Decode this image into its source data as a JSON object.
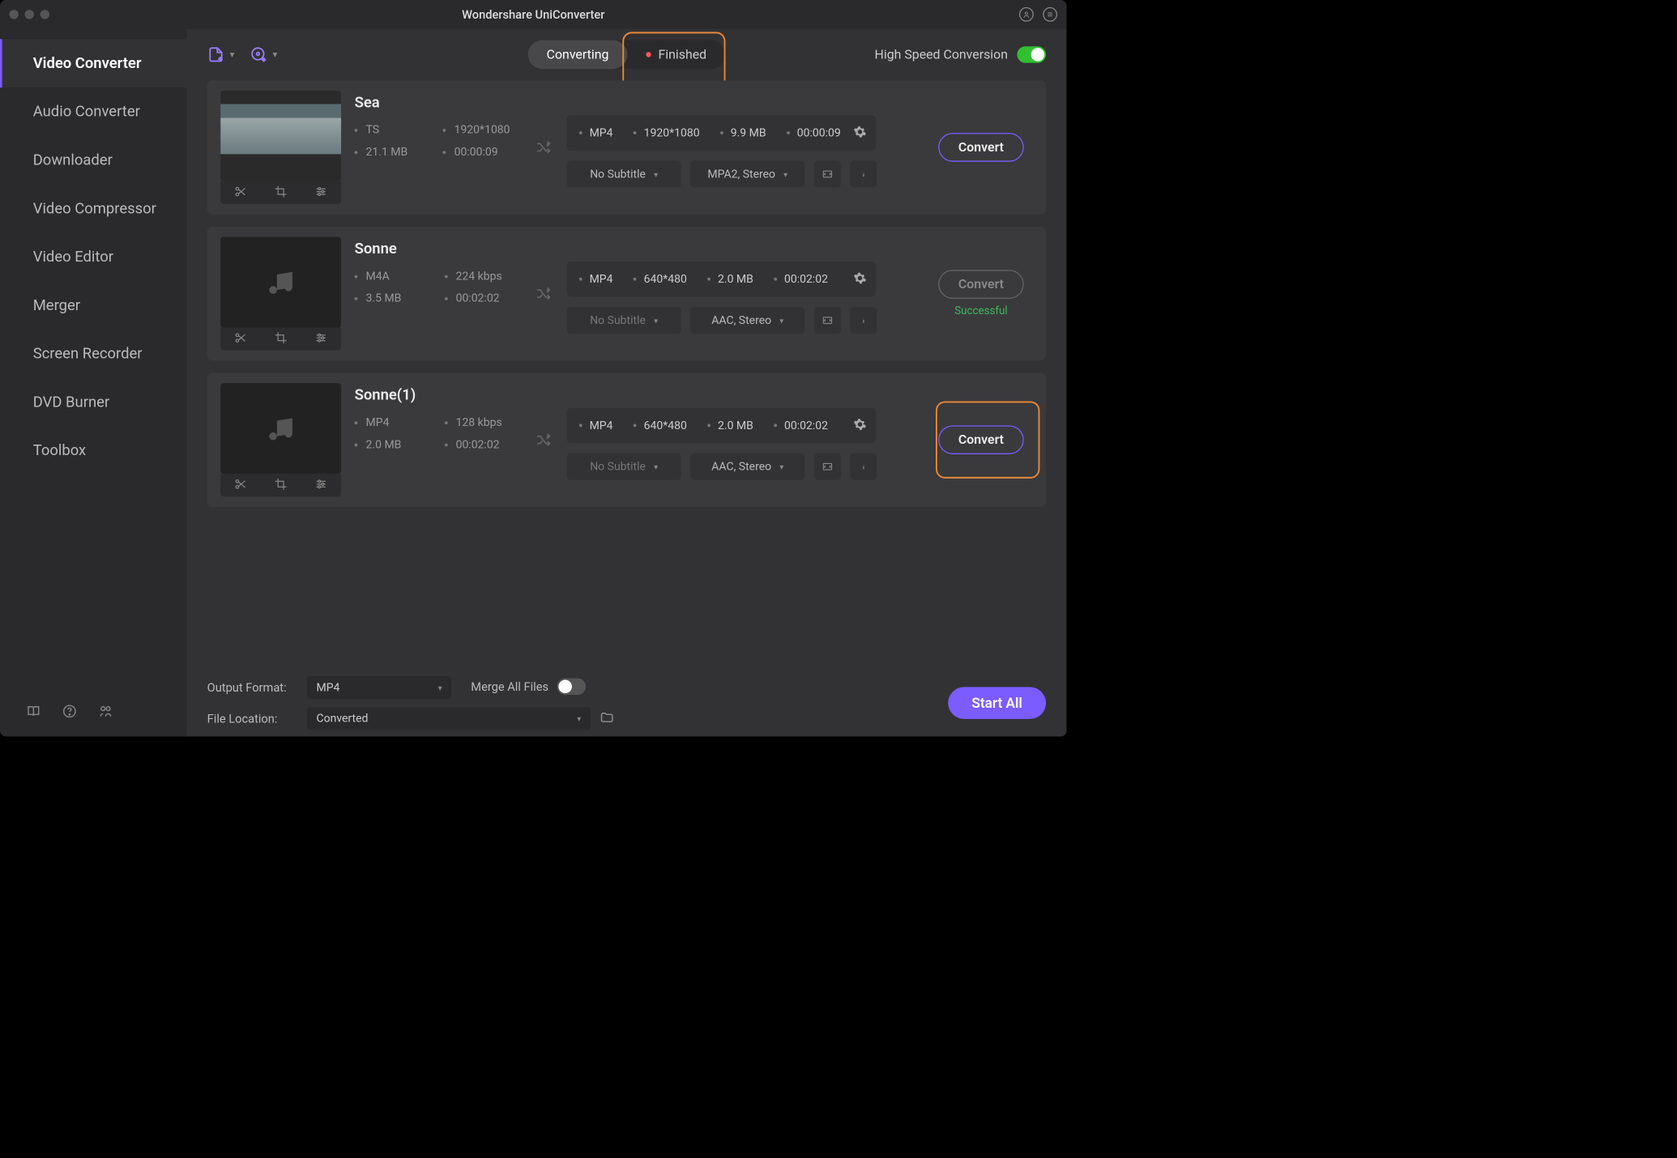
{
  "title": "Wondershare UniConverter",
  "sidebar": {
    "items": [
      "Video Converter",
      "Audio Converter",
      "Downloader",
      "Video Compressor",
      "Video Editor",
      "Merger",
      "Screen Recorder",
      "DVD Burner",
      "Toolbox"
    ],
    "active_index": 0
  },
  "tabs": {
    "converting": "Converting",
    "finished": "Finished"
  },
  "high_speed": {
    "label": "High Speed Conversion",
    "on": true
  },
  "items": [
    {
      "title": "Sea",
      "thumb": "sea",
      "src_meta": [
        "TS",
        "1920*1080",
        "21.1 MB",
        "00:00:09"
      ],
      "out_meta": [
        "MP4",
        "1920*1080",
        "9.9 MB",
        "00:00:09"
      ],
      "subtitle": "No Subtitle",
      "audio": "MPA2, Stereo",
      "convert_label": "Convert",
      "disabled": false,
      "status": "",
      "highlight": false
    },
    {
      "title": "Sonne",
      "thumb": "music",
      "src_meta": [
        "M4A",
        "224 kbps",
        "3.5 MB",
        "00:02:02"
      ],
      "out_meta": [
        "MP4",
        "640*480",
        "2.0 MB",
        "00:02:02"
      ],
      "subtitle": "No Subtitle",
      "audio": "AAC, Stereo",
      "convert_label": "Convert",
      "disabled": true,
      "status": "Successful",
      "highlight": false
    },
    {
      "title": "Sonne(1)",
      "thumb": "music",
      "src_meta": [
        "MP4",
        "128 kbps",
        "2.0 MB",
        "00:02:02"
      ],
      "out_meta": [
        "MP4",
        "640*480",
        "2.0 MB",
        "00:02:02"
      ],
      "subtitle": "No Subtitle",
      "audio": "AAC, Stereo",
      "convert_label": "Convert",
      "disabled": false,
      "status": "",
      "highlight": true
    }
  ],
  "footer": {
    "output_format_label": "Output Format:",
    "output_format_value": "MP4",
    "file_location_label": "File Location:",
    "file_location_value": "Converted",
    "merge_label": "Merge All Files",
    "merge_on": false,
    "start_label": "Start All"
  }
}
